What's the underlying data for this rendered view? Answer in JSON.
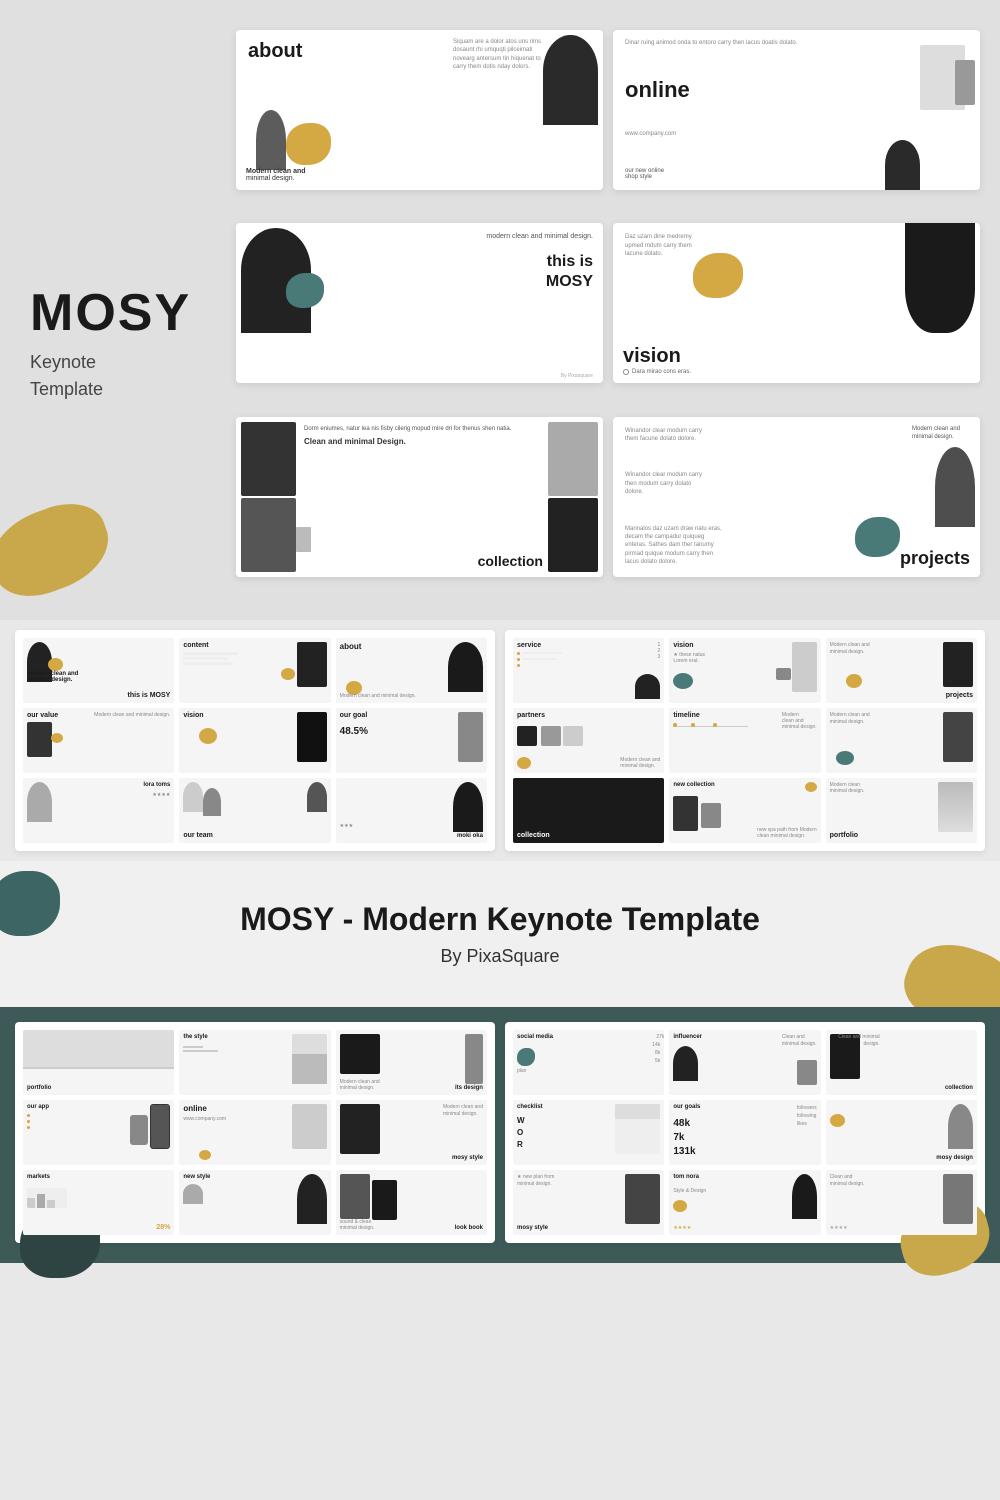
{
  "brand": {
    "title": "MOSY",
    "subtitle_line1": "Keynote",
    "subtitle_line2": "Template"
  },
  "banner": {
    "title": "MOSY - Modern Keynote Template",
    "by": "By PixaSquare"
  },
  "slides": {
    "about": {
      "heading": "about",
      "sub1": "Modern clean and",
      "sub2": "minimal design."
    },
    "this_is": {
      "heading": "this is",
      "title2": "MOSY",
      "sub": "modern clean and minimal design."
    },
    "collection": {
      "heading": "collection",
      "sub": "Clean and minimal Design."
    },
    "online": {
      "heading": "online",
      "sub1": "our new online",
      "sub2": "shop style",
      "url": "www.company.com"
    },
    "vision": {
      "heading": "vision",
      "sub": "Dara mirao cons eras."
    },
    "projects": {
      "heading": "projects",
      "sub": "Modern clean and minimal design."
    }
  },
  "thumb_labels_left": [
    [
      "this is MOSY",
      "content",
      "about"
    ],
    [
      "our value",
      "vision",
      "our goal"
    ],
    [
      "lora toms",
      "our team",
      "moki oka"
    ]
  ],
  "thumb_labels_right": [
    [
      "service",
      "vision",
      "projects"
    ],
    [
      "partners",
      "timeline",
      ""
    ],
    [
      "collection",
      "new collection",
      "portfolio"
    ]
  ],
  "thumb_labels_bottom_left": [
    [
      "portfolio",
      "the style",
      "its design"
    ],
    [
      "our app",
      "online",
      "mosy style"
    ],
    [
      "markets",
      "new style",
      "look book"
    ]
  ],
  "thumb_labels_bottom_right": [
    [
      "plan social media",
      "influencer",
      "collection"
    ],
    [
      "checklist",
      "our goals",
      "mosy design"
    ],
    [
      "mosy style",
      "tom nora",
      ""
    ]
  ],
  "colors": {
    "gold": "#d4a843",
    "teal": "#4a7a78",
    "dark": "#1a1a1a",
    "bg_light": "#e0e0e0",
    "bg_dark": "#3d5a59"
  }
}
